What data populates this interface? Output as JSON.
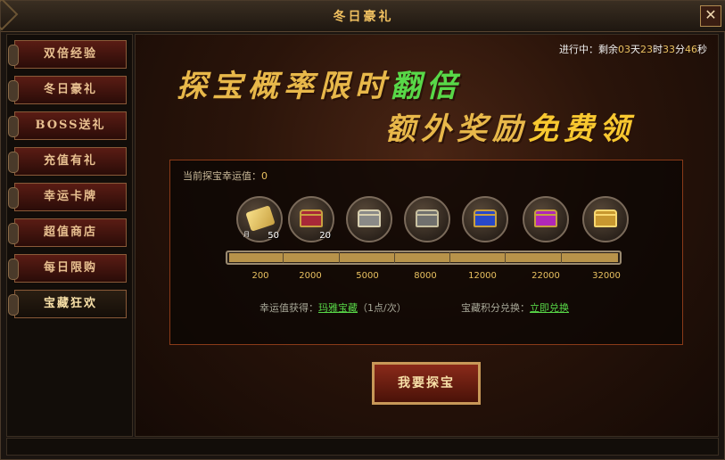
{
  "window": {
    "title": "冬日豪礼",
    "close_label": "✕"
  },
  "sidebar": {
    "items": [
      {
        "label": "双倍经验"
      },
      {
        "label": "冬日豪礼"
      },
      {
        "label": "BOSS送礼"
      },
      {
        "label": "充值有礼"
      },
      {
        "label": "幸运卡牌"
      },
      {
        "label": "超值商店"
      },
      {
        "label": "每日限购"
      },
      {
        "label": "宝藏狂欢"
      }
    ],
    "active_index": 7
  },
  "status": {
    "prefix": "进行中：剩余",
    "days": "03",
    "days_unit": "天",
    "hours": "23",
    "hours_unit": "时",
    "minutes": "33",
    "minutes_unit": "分",
    "seconds": "46",
    "seconds_unit": "秒"
  },
  "banner": {
    "line1": "探宝概率限时",
    "line1_highlight": "翻倍",
    "line2": "额外奖励",
    "line2_highlight": "免费领"
  },
  "panel": {
    "luck_label": "当前探宝幸运值：",
    "luck_value": "0",
    "chests": [
      {
        "icon": "scroll-icon",
        "count": "50",
        "tag": "月"
      },
      {
        "icon": "red-chest-icon",
        "count": "20"
      },
      {
        "icon": "silver-chest-icon"
      },
      {
        "icon": "silver-chest-icon-2"
      },
      {
        "icon": "blue-chest-icon"
      },
      {
        "icon": "purple-chest-icon"
      },
      {
        "icon": "gold-chest-icon"
      }
    ],
    "progress_fraction": 0.0,
    "ticks": [
      "200",
      "2000",
      "5000",
      "8000",
      "12000",
      "22000",
      "32000"
    ],
    "earn_label": "幸运值获得：",
    "earn_link": "玛雅宝藏",
    "earn_note": "（1点/次）",
    "exchange_label": "宝藏积分兑换：",
    "exchange_link": "立即兑换"
  },
  "action_button": {
    "label": "我要探宝"
  },
  "colors": {
    "accent": "#e8c060",
    "highlight_green": "#58d848",
    "border_red": "#8a3a18"
  }
}
